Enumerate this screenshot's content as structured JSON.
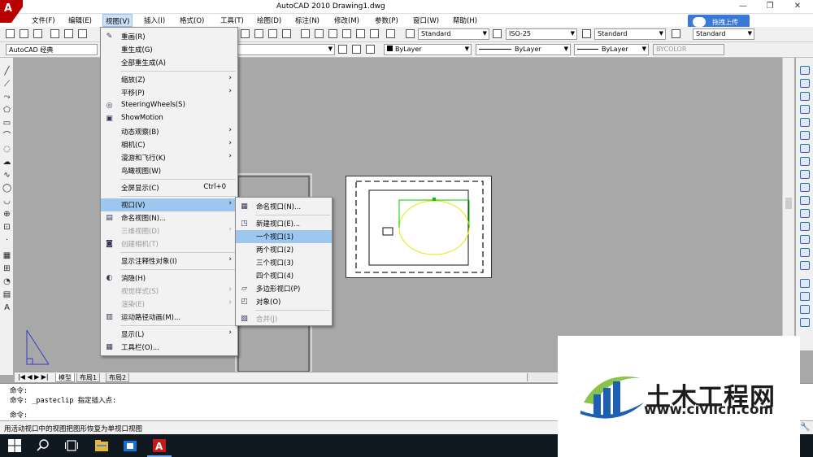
{
  "window": {
    "title": "AutoCAD 2010    Drawing1.dwg",
    "logo_letter": "A"
  },
  "menubar": [
    "文件(F)",
    "编辑(E)",
    "视图(V)",
    "插入(I)",
    "格式(O)",
    "工具(T)",
    "绘图(D)",
    "标注(N)",
    "修改(M)",
    "参数(P)",
    "窗口(W)",
    "帮助(H)"
  ],
  "upload_button": "拖拽上传",
  "toolbar": {
    "text_style": "Standard",
    "dim_style": "ISO-25",
    "table_style": "Standard",
    "multileader_style": "Standard",
    "workspace": "AutoCAD 经典",
    "color": "ByLayer",
    "linetype": "ByLayer",
    "lineweight": "ByLayer",
    "plotstyle": "BYCOLOR"
  },
  "view_menu": [
    {
      "label": "重画(R)",
      "icon": "pencil-icon"
    },
    {
      "label": "重生成(G)"
    },
    {
      "label": "全部重生成(A)"
    },
    {
      "sep": true
    },
    {
      "label": "缩放(Z)",
      "submenu": true
    },
    {
      "label": "平移(P)",
      "submenu": true
    },
    {
      "label": "SteeringWheels(S)",
      "icon": "steeringwheel-icon"
    },
    {
      "label": "ShowMotion",
      "icon": "showmotion-icon"
    },
    {
      "label": "动态观察(B)",
      "submenu": true
    },
    {
      "label": "相机(C)",
      "submenu": true
    },
    {
      "label": "漫游和飞行(K)",
      "submenu": true
    },
    {
      "label": "鸟瞰视图(W)"
    },
    {
      "sep": true
    },
    {
      "label": "全屏显示(C)",
      "shortcut": "Ctrl+0"
    },
    {
      "sep": true
    },
    {
      "label": "视口(V)",
      "submenu": true,
      "highlight": true
    },
    {
      "label": "命名视图(N)...",
      "icon": "named-view-icon"
    },
    {
      "label": "三维视图(D)",
      "submenu": true,
      "disabled": true
    },
    {
      "label": "创建相机(T)",
      "disabled": true,
      "icon": "camera-icon"
    },
    {
      "sep": true
    },
    {
      "label": "显示注释性对象(I)",
      "submenu": true
    },
    {
      "sep": true
    },
    {
      "label": "消隐(H)",
      "icon": "hide-icon"
    },
    {
      "label": "视觉样式(S)",
      "submenu": true,
      "disabled": true
    },
    {
      "label": "渲染(E)",
      "submenu": true,
      "disabled": true
    },
    {
      "label": "运动路径动画(M)...",
      "icon": "motion-path-icon"
    },
    {
      "sep": true
    },
    {
      "label": "显示(L)",
      "submenu": true
    },
    {
      "label": "工具栏(O)...",
      "icon": "toolbar-icon"
    }
  ],
  "viewports_menu": [
    {
      "label": "命名视口(N)...",
      "icon": "named-viewport-icon"
    },
    {
      "sep": true
    },
    {
      "label": "新建视口(E)...",
      "icon": "new-viewport-icon"
    },
    {
      "label": "一个视口(1)",
      "highlight": true
    },
    {
      "label": "两个视口(2)"
    },
    {
      "label": "三个视口(3)"
    },
    {
      "label": "四个视口(4)"
    },
    {
      "label": "多边形视口(P)",
      "icon": "polygon-viewport-icon"
    },
    {
      "label": "对象(O)",
      "icon": "object-viewport-icon"
    },
    {
      "sep": true
    },
    {
      "label": "合并(J)",
      "disabled": true,
      "icon": "join-icon"
    }
  ],
  "layout_tabs": [
    "模型",
    "布局1",
    "布局2"
  ],
  "command_lines": [
    "命令:",
    "命令: _pasteclip 指定插入点:",
    "命令:"
  ],
  "status_text": "用活动视口中的视图把图形恢复为单视口视图",
  "watermark": {
    "title": "土木工程网",
    "url": "www.civilcn.com"
  }
}
